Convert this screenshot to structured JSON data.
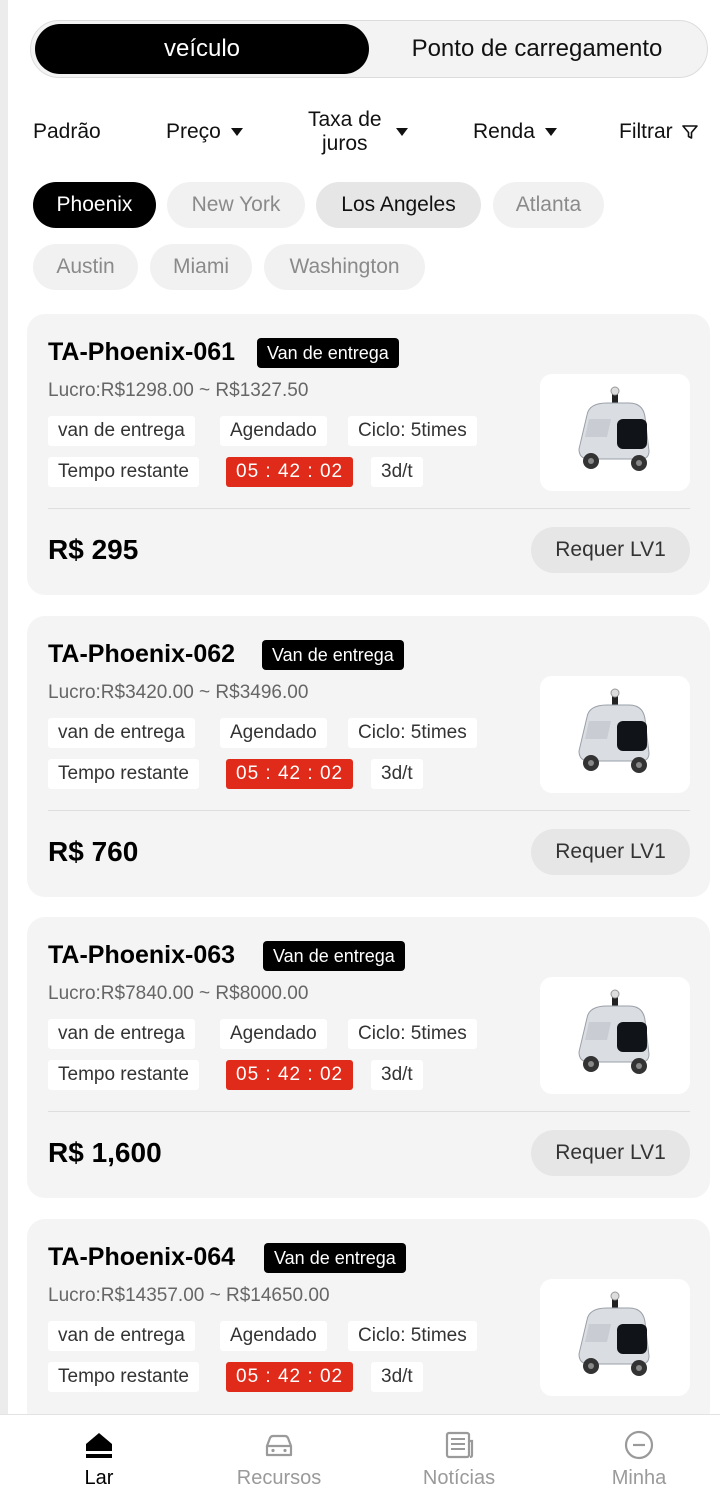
{
  "tabs": {
    "active": "veículo",
    "inactive": "Ponto de carregamento"
  },
  "sort": {
    "padrao": "Padrão",
    "preco": "Preço",
    "taxa_line1": "Taxa de",
    "taxa_line2": "juros",
    "renda": "Renda",
    "filtrar": "Filtrar"
  },
  "cities": [
    "Phoenix",
    "New York",
    "Los Angeles",
    "Atlanta",
    "Austin",
    "Miami",
    "Washington"
  ],
  "selected_city": "Phoenix",
  "cards": [
    {
      "title": "TA-Phoenix-061",
      "badge": "Van de entrega",
      "profit": "Lucro:R$1298.00 ~ R$1327.50",
      "tags": [
        "van de entrega",
        "Agendado",
        "Ciclo: 5times"
      ],
      "remaining_label": "Tempo restante",
      "timer": "05 : 42 : 02",
      "rate": "3d/t",
      "price": "R$ 295",
      "button": "Requer LV1"
    },
    {
      "title": "TA-Phoenix-062",
      "badge": "Van de entrega",
      "profit": "Lucro:R$3420.00 ~ R$3496.00",
      "tags": [
        "van de entrega",
        "Agendado",
        "Ciclo: 5times"
      ],
      "remaining_label": "Tempo restante",
      "timer": "05 : 42 : 02",
      "rate": "3d/t",
      "price": "R$ 760",
      "button": "Requer LV1"
    },
    {
      "title": "TA-Phoenix-063",
      "badge": "Van de entrega",
      "profit": "Lucro:R$7840.00 ~ R$8000.00",
      "tags": [
        "van de entrega",
        "Agendado",
        "Ciclo: 5times"
      ],
      "remaining_label": "Tempo restante",
      "timer": "05 : 42 : 02",
      "rate": "3d/t",
      "price": "R$ 1,600",
      "button": "Requer LV1"
    },
    {
      "title": "TA-Phoenix-064",
      "badge": "Van de entrega",
      "profit": "Lucro:R$14357.00 ~ R$14650.00",
      "tags": [
        "van de entrega",
        "Agendado",
        "Ciclo: 5times"
      ],
      "remaining_label": "Tempo restante",
      "timer": "05 : 42 : 02",
      "rate": "3d/t",
      "price": "",
      "button": ""
    }
  ],
  "nav": [
    {
      "label": "Lar",
      "icon": "home-icon",
      "active": true
    },
    {
      "label": "Recursos",
      "icon": "car-icon",
      "active": false
    },
    {
      "label": "Notícias",
      "icon": "news-icon",
      "active": false
    },
    {
      "label": "Minha",
      "icon": "profile-icon",
      "active": false
    }
  ],
  "colors": {
    "accent": "#000000",
    "timer_bg": "#e02b1a",
    "card_bg": "#f4f4f4"
  }
}
